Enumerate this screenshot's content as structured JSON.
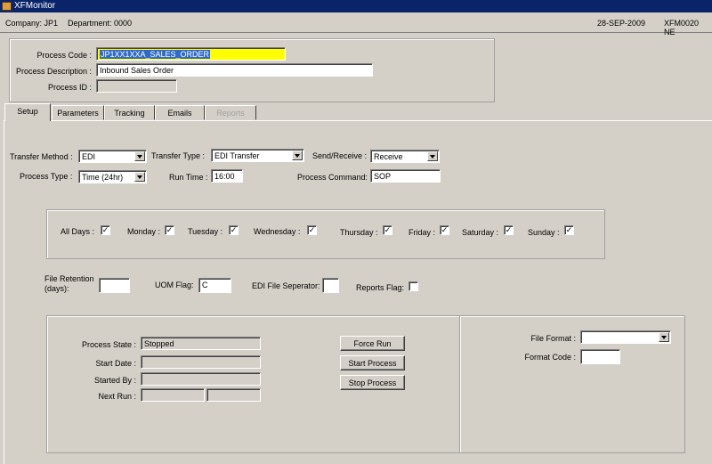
{
  "window": {
    "title": "XFMonitor"
  },
  "info": {
    "company": "Company: JP1",
    "department": "Department: 0000",
    "date": "28-SEP-2009",
    "module": "XFM0020 NE"
  },
  "header": {
    "process_code_label": "Process Code :",
    "process_code": "JP1XX1XXA_SALES_ORDER",
    "process_desc_label": "Process Description :",
    "process_desc": "Inbound Sales Order",
    "process_id_label": "Process ID :",
    "process_id": ""
  },
  "tabs": [
    {
      "label": "Setup",
      "state": "active"
    },
    {
      "label": "Parameters",
      "state": "normal"
    },
    {
      "label": "Tracking",
      "state": "normal"
    },
    {
      "label": "Emails",
      "state": "normal"
    },
    {
      "label": "Reports",
      "state": "disabled"
    }
  ],
  "setup": {
    "transfer_method_label": "Transfer Method :",
    "transfer_method": "EDI",
    "transfer_type_label": "Transfer Type :",
    "transfer_type": "EDI Transfer",
    "send_receive_label": "Send/Receive :",
    "send_receive": "Receive",
    "process_type_label": "Process Type :",
    "process_type": "Time (24hr)",
    "run_time_label": "Run Time :",
    "run_time": "16:00",
    "process_command_label": "Process Command:",
    "process_command": "SOP"
  },
  "days": [
    {
      "label": "All Days :",
      "checked": true
    },
    {
      "label": "Monday :",
      "checked": true
    },
    {
      "label": "Tuesday :",
      "checked": true
    },
    {
      "label": "Wednesday :",
      "checked": true
    },
    {
      "label": "Thursday :",
      "checked": true
    },
    {
      "label": "Friday :",
      "checked": true
    },
    {
      "label": "Saturday :",
      "checked": true
    },
    {
      "label": "Sunday :",
      "checked": true
    }
  ],
  "check_glyph": "✓",
  "misc": {
    "file_retention_label_1": "File Retention",
    "file_retention_label_2": "(days):",
    "file_retention": "",
    "uom_flag_label": "UOM Flag:",
    "uom_flag": "C",
    "edi_sep_label": "EDI File Seperator:",
    "edi_sep": "",
    "reports_flag_label": "Reports Flag:",
    "reports_flag": false
  },
  "status": {
    "process_state_label": "Process State :",
    "process_state": "Stopped",
    "start_date_label": "Start Date :",
    "start_date": "",
    "started_by_label": "Started By :",
    "started_by": "",
    "next_run_label": "Next Run :",
    "next_run_1": "",
    "next_run_2": ""
  },
  "buttons": {
    "force_run": "Force Run",
    "start_process": "Start Process",
    "stop_process": "Stop Process"
  },
  "format": {
    "file_format_label": "File Format :",
    "file_format": "",
    "format_code_label": "Format Code :",
    "format_code": ""
  },
  "colors": {
    "accent": "#0a246a",
    "highlight": "#ffff00",
    "selection": "#316ac5",
    "face": "#d4d0c8"
  }
}
